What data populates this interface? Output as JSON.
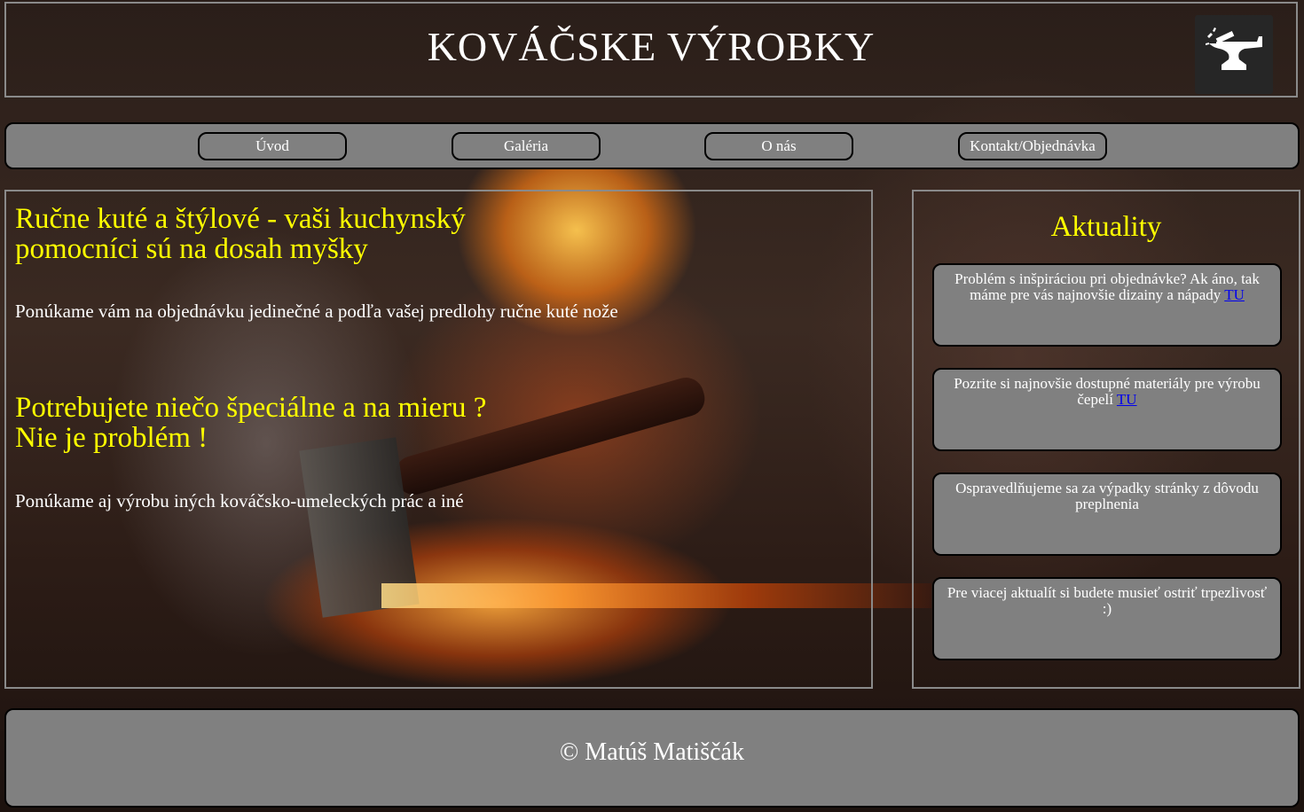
{
  "header": {
    "title": "KOVÁČSKE VÝROBKY",
    "logo_icon": "anvil-icon"
  },
  "nav": {
    "items": [
      {
        "label": "Úvod"
      },
      {
        "label": "Galéria"
      },
      {
        "label": "O nás"
      },
      {
        "label": "Kontakt/Objednávka"
      }
    ]
  },
  "main": {
    "heading1_line1": "Ručne kuté a štýlové - vaši kuchynský",
    "heading1_line2": "pomocníci sú na dosah myšky",
    "paragraph1": "Ponúkame vám na objednávku jedinečné a podľa vašej predlohy ručne kuté nože",
    "heading2_line1": "Potrebujete niečo špeciálne a na mieru ?",
    "heading2_line2": "Nie je problém !",
    "paragraph2": "Ponúkame aj výrobu iných kováčsko-umeleckých prác a iné"
  },
  "aside": {
    "title": "Aktuality",
    "cards": [
      {
        "text": "Problém s inšpiráciou pri objednávke? Ak áno, tak máme pre vás najnovšie dizainy a nápady ",
        "link": "TU"
      },
      {
        "text": "Pozrite si najnovšie dostupné materiály pre výrobu čepelí ",
        "link": "TU"
      },
      {
        "text": "Ospravedlňujeme sa za výpadky stránky z dôvodu preplnenia",
        "link": ""
      },
      {
        "text": "Pre viacej aktualít si budete musieť ostriť trpezlivosť :)",
        "link": ""
      }
    ]
  },
  "footer": {
    "text": "© Matúš Matiščák"
  },
  "colors": {
    "accent_yellow": "#ffff00",
    "panel_gray": "#808080",
    "link_blue": "#0000ee"
  }
}
